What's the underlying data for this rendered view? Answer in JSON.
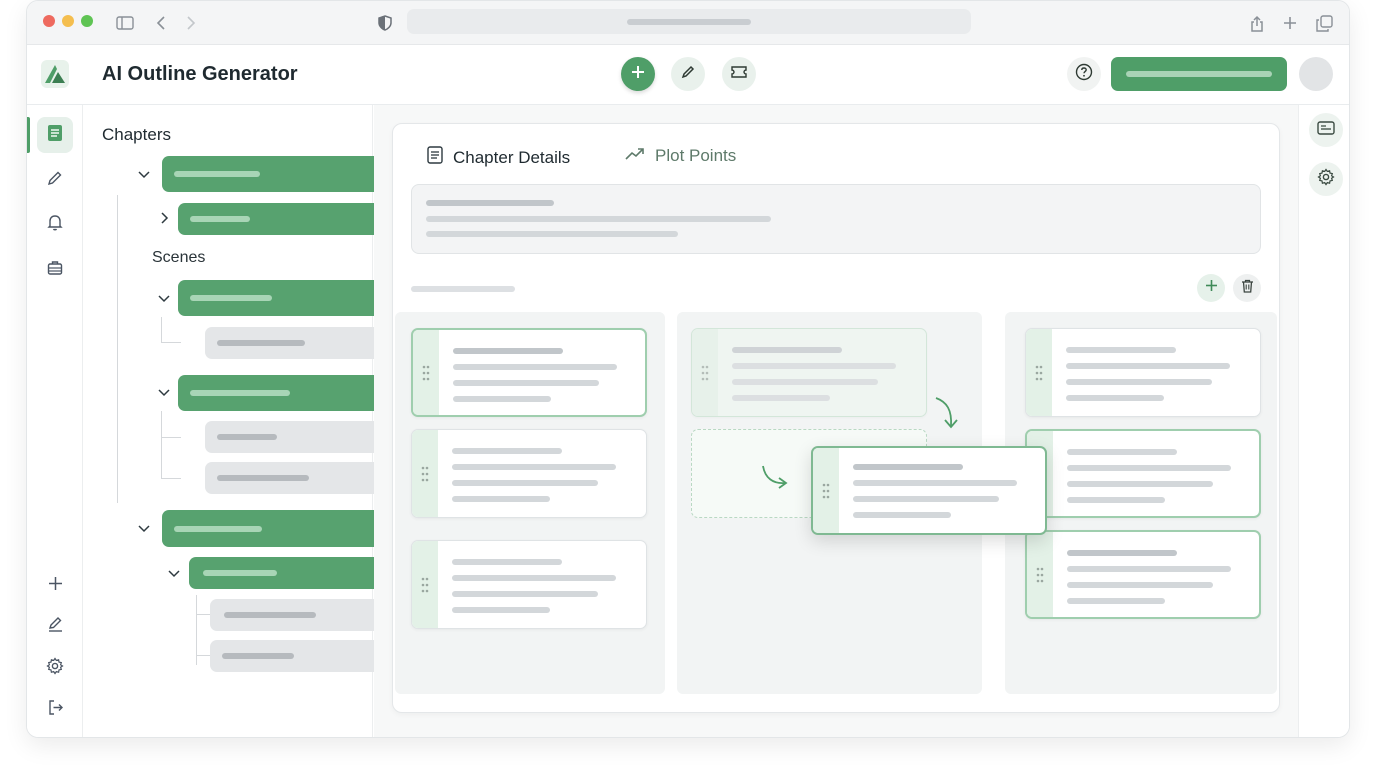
{
  "app": {
    "title": "AI Outline Generator"
  },
  "sidebar_panel": {
    "title": "Chapters",
    "scenes_label": "Scenes"
  },
  "tabs": [
    {
      "label": "Chapter Details",
      "icon": "document-icon",
      "active": true
    },
    {
      "label": "Plot Points",
      "icon": "trend-icon",
      "active": false
    }
  ],
  "rail": {
    "top_items": [
      "document-icon",
      "pencil-icon",
      "bell-icon",
      "briefcase-icon"
    ],
    "bottom_items": [
      "plus-icon",
      "edit-icon",
      "gear-icon",
      "logout-icon"
    ]
  },
  "header_actions": [
    "plus-icon",
    "pencil-icon",
    "ticket-icon",
    "help-icon"
  ],
  "colors": {
    "accent": "#4f9e68",
    "accent_light": "#e6f0ea"
  }
}
